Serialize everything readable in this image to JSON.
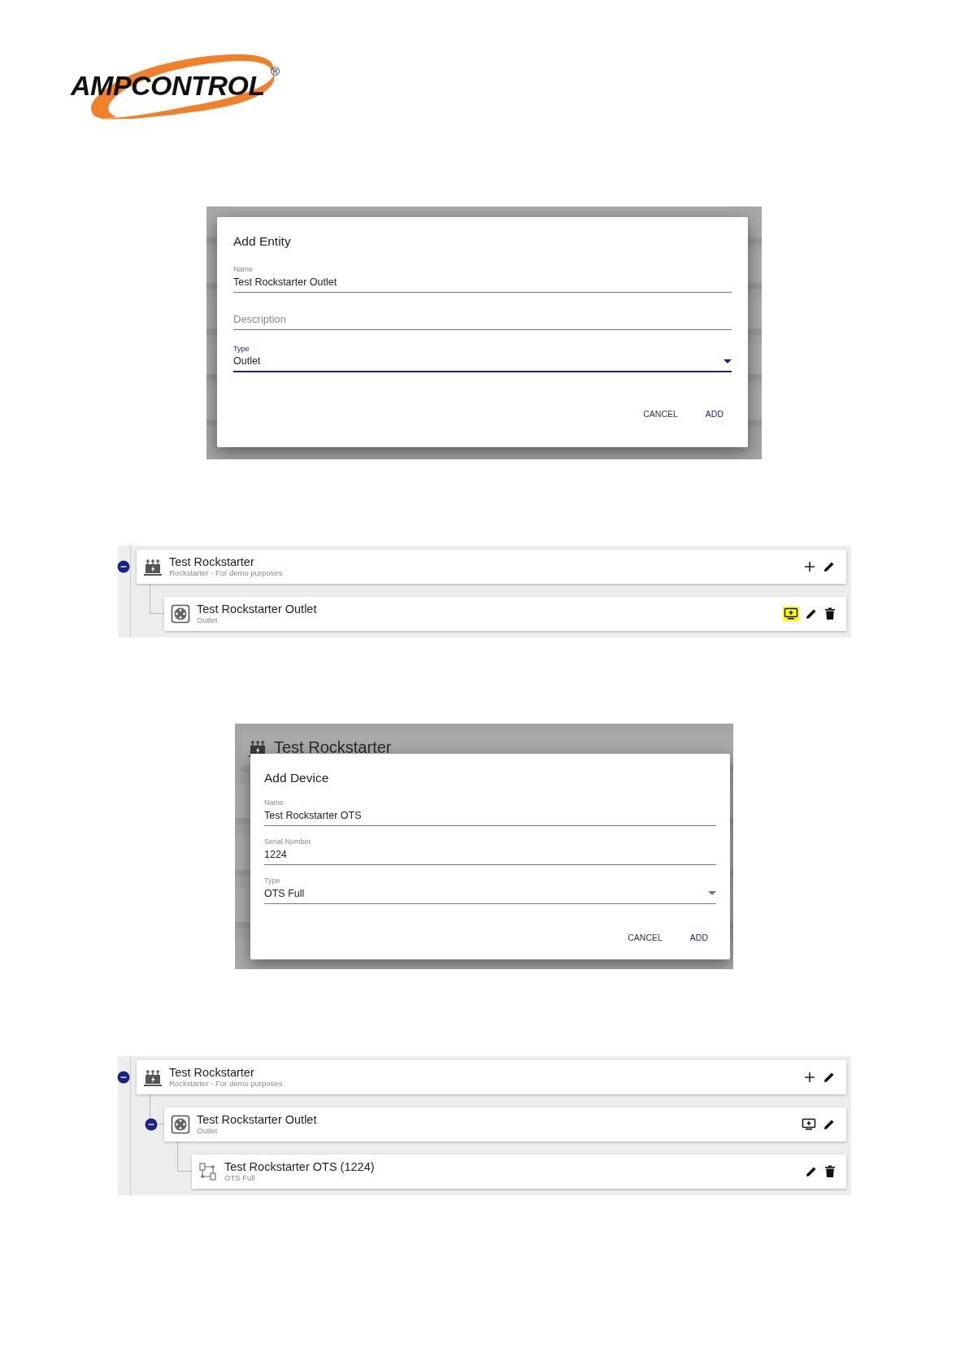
{
  "logo": {
    "text": "AMPCONTROL",
    "mark": "®"
  },
  "sections": [
    {
      "kind": "dialog",
      "title": "Add Entity",
      "fields": [
        {
          "label": "Name",
          "value": "Test Rockstarter Outlet",
          "focused": false,
          "dropdown": false
        },
        {
          "placeholder": "Description",
          "focused": false,
          "dropdown": false
        },
        {
          "label": "Type",
          "value": "Outlet",
          "focused": true,
          "dropdown": true
        }
      ],
      "buttons": [
        {
          "label": "CANCEL",
          "primary": false
        },
        {
          "label": "ADD",
          "primary": true
        }
      ]
    },
    {
      "kind": "tree",
      "nodes": [
        {
          "title": "Test Rockstarter",
          "subtitle": "Rockstarter - For demo purposes",
          "kind": "rockstarter",
          "expanded": true,
          "actions": [
            {
              "kind": "add",
              "highlighted": false
            },
            {
              "kind": "edit",
              "highlighted": false
            }
          ],
          "children": [
            {
              "title": "Test Rockstarter Outlet",
              "subtitle": "Outlet",
              "kind": "outlet",
              "actions": [
                {
                  "kind": "add-device",
                  "highlighted": true
                },
                {
                  "kind": "edit",
                  "highlighted": false
                },
                {
                  "kind": "delete",
                  "highlighted": false
                }
              ]
            }
          ]
        }
      ]
    },
    {
      "kind": "dialog",
      "background_items": [
        {
          "title": "Test Rockstarter"
        }
      ],
      "title": "Add Device",
      "fields": [
        {
          "label": "Name",
          "value": "Test Rockstarter OTS",
          "focused": false,
          "dropdown": false
        },
        {
          "label": "Serial Number",
          "value": "1224",
          "focused": false,
          "dropdown": false
        },
        {
          "label": "Type",
          "value": "OTS Full",
          "focused": false,
          "dropdown": true
        }
      ],
      "buttons": [
        {
          "label": "CANCEL",
          "primary": false
        },
        {
          "label": "ADD",
          "primary": true
        }
      ]
    },
    {
      "kind": "tree",
      "nodes": [
        {
          "title": "Test Rockstarter",
          "subtitle": "Rockstarter - For demo purposes",
          "kind": "rockstarter",
          "expanded": true,
          "actions": [
            {
              "kind": "add",
              "highlighted": false
            },
            {
              "kind": "edit",
              "highlighted": false
            }
          ],
          "children": [
            {
              "title": "Test Rockstarter Outlet",
              "subtitle": "Outlet",
              "kind": "outlet",
              "expanded": true,
              "actions": [
                {
                  "kind": "add-device",
                  "highlighted": false
                },
                {
                  "kind": "edit",
                  "highlighted": false
                }
              ],
              "children": [
                {
                  "title": "Test Rockstarter OTS (1224)",
                  "subtitle": "OTS Full",
                  "kind": "ots",
                  "actions": [
                    {
                      "kind": "edit",
                      "highlighted": false
                    },
                    {
                      "kind": "delete",
                      "highlighted": false
                    }
                  ]
                }
              ]
            }
          ]
        }
      ]
    }
  ]
}
